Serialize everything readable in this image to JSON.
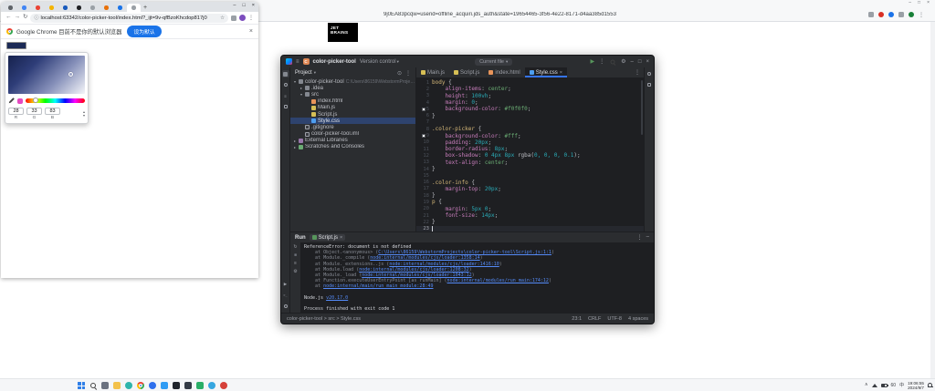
{
  "background_browser": {
    "url_fragment": "9j0EA83pcqw=userid=offline_acquiri.jds_auth&state=19654465-3f56-4e22-8171-d4aa385d1553",
    "logo_line1": "JET",
    "logo_line2": "BRAINS"
  },
  "chrome": {
    "tabs": [
      "#5f6368",
      "#4285f4",
      "#ea4335",
      "#f4b400",
      "#185abc",
      "#202124",
      "#9aa0a6",
      "#e8710a",
      "#1a73e8",
      "#9aa0a6"
    ],
    "active_tab": 9,
    "url": "localhost:63342/color-picker-tool/index.html?_ijt=9v-qfBzoKhcdop817j0",
    "notification": {
      "text": "Google Chrome 目前不是你的默认浏览器",
      "button_label": "设为默认"
    },
    "picker": {
      "rgb": [
        "28",
        "33",
        "83"
      ],
      "labels": [
        "R",
        "G",
        "B"
      ]
    }
  },
  "ide": {
    "title": {
      "project": "color-picker-tool",
      "project_initial": "C",
      "vcs": "Version control",
      "run_widget": "Current file"
    },
    "project_panel": {
      "header": "Project",
      "tree": [
        {
          "label": "color-picker-tool",
          "suffix": "C:\\Users\\86159\\WebstormProjects\\color-picker-tool",
          "indent": 0,
          "icon": "folder",
          "chev": "v"
        },
        {
          "label": ".idea",
          "indent": 1,
          "icon": "folder",
          "chev": ">"
        },
        {
          "label": "src",
          "indent": 1,
          "icon": "folder",
          "chev": "v"
        },
        {
          "label": "index.html",
          "indent": 2,
          "icon": "html"
        },
        {
          "label": "Main.js",
          "indent": 2,
          "icon": "js"
        },
        {
          "label": "Script.js",
          "indent": 2,
          "icon": "js"
        },
        {
          "label": "Style.css",
          "indent": 2,
          "icon": "css",
          "selected": true
        },
        {
          "label": ".gitignore",
          "indent": 1,
          "icon": "file"
        },
        {
          "label": "color-picker-tool.iml",
          "indent": 1,
          "icon": "file"
        },
        {
          "label": "External Libraries",
          "indent": 0,
          "icon": "lib",
          "chev": ">"
        },
        {
          "label": "Scratches and Consoles",
          "indent": 0,
          "icon": "scratch",
          "chev": ">"
        }
      ]
    },
    "editor": {
      "tabs": [
        {
          "label": "Main.js",
          "icon": "js"
        },
        {
          "label": "Script.js",
          "icon": "js"
        },
        {
          "label": "index.html",
          "icon": "html"
        },
        {
          "label": "Style.css",
          "icon": "css",
          "active": true
        }
      ],
      "lines": [
        {
          "n": "1",
          "parts": [
            [
              "sel",
              "body "
            ],
            [
              "pun",
              "{"
            ]
          ]
        },
        {
          "n": "2",
          "parts": [
            [
              "ws",
              "    "
            ],
            [
              "prop",
              "align-items"
            ],
            [
              "pun",
              ": "
            ],
            [
              "val",
              "center"
            ],
            [
              "pun",
              ";"
            ]
          ]
        },
        {
          "n": "3",
          "parts": [
            [
              "ws",
              "    "
            ],
            [
              "prop",
              "height"
            ],
            [
              "pun",
              ": "
            ],
            [
              "num",
              "100vh"
            ],
            [
              "pun",
              ";"
            ]
          ]
        },
        {
          "n": "4",
          "parts": [
            [
              "ws",
              "    "
            ],
            [
              "prop",
              "margin"
            ],
            [
              "pun",
              ": "
            ],
            [
              "num",
              "0"
            ],
            [
              "pun",
              ";"
            ]
          ]
        },
        {
          "n": "5",
          "swatch": "#f0f0f0",
          "parts": [
            [
              "ws",
              "    "
            ],
            [
              "prop",
              "background-color"
            ],
            [
              "pun",
              ": "
            ],
            [
              "val",
              "#f0f0f0"
            ],
            [
              "pun",
              ";"
            ]
          ]
        },
        {
          "n": "6",
          "parts": [
            [
              "pun",
              "}"
            ]
          ]
        },
        {
          "n": "7",
          "parts": []
        },
        {
          "n": "8",
          "parts": [
            [
              "sel",
              ".color-picker "
            ],
            [
              "pun",
              "{"
            ]
          ]
        },
        {
          "n": "9",
          "swatch": "#ffffff",
          "parts": [
            [
              "ws",
              "    "
            ],
            [
              "prop",
              "background-color"
            ],
            [
              "pun",
              ": "
            ],
            [
              "val",
              "#fff"
            ],
            [
              "pun",
              ";"
            ]
          ]
        },
        {
          "n": "10",
          "parts": [
            [
              "ws",
              "    "
            ],
            [
              "prop",
              "padding"
            ],
            [
              "pun",
              ": "
            ],
            [
              "num",
              "20px"
            ],
            [
              "pun",
              ";"
            ]
          ]
        },
        {
          "n": "11",
          "parts": [
            [
              "ws",
              "    "
            ],
            [
              "prop",
              "border-radius"
            ],
            [
              "pun",
              ": "
            ],
            [
              "num",
              "8px"
            ],
            [
              "pun",
              ";"
            ]
          ]
        },
        {
          "n": "12",
          "parts": [
            [
              "ws",
              "    "
            ],
            [
              "prop",
              "box-shadow"
            ],
            [
              "pun",
              ": "
            ],
            [
              "num",
              "0 4px 8px"
            ],
            [
              "pun",
              " rgba("
            ],
            [
              "num",
              "0, 0, 0, 0.1"
            ],
            [
              "pun",
              ");"
            ]
          ]
        },
        {
          "n": "13",
          "parts": [
            [
              "ws",
              "    "
            ],
            [
              "prop",
              "text-align"
            ],
            [
              "pun",
              ": "
            ],
            [
              "val",
              "center"
            ],
            [
              "pun",
              ";"
            ]
          ]
        },
        {
          "n": "14",
          "parts": [
            [
              "pun",
              "}"
            ]
          ]
        },
        {
          "n": "15",
          "parts": []
        },
        {
          "n": "16",
          "parts": [
            [
              "sel",
              ".color-info "
            ],
            [
              "pun",
              "{"
            ]
          ]
        },
        {
          "n": "17",
          "parts": [
            [
              "ws",
              "    "
            ],
            [
              "prop",
              "margin-top"
            ],
            [
              "pun",
              ": "
            ],
            [
              "num",
              "20px"
            ],
            [
              "pun",
              ";"
            ]
          ]
        },
        {
          "n": "18",
          "parts": [
            [
              "pun",
              "}"
            ]
          ]
        },
        {
          "n": "19",
          "parts": [
            [
              "sel",
              "p "
            ],
            [
              "pun",
              "{"
            ]
          ]
        },
        {
          "n": "20",
          "parts": [
            [
              "ws",
              "    "
            ],
            [
              "prop",
              "margin"
            ],
            [
              "pun",
              ": "
            ],
            [
              "num",
              "5px 0"
            ],
            [
              "pun",
              ";"
            ]
          ]
        },
        {
          "n": "21",
          "parts": [
            [
              "ws",
              "    "
            ],
            [
              "prop",
              "font-size"
            ],
            [
              "pun",
              ": "
            ],
            [
              "num",
              "14px"
            ],
            [
              "pun",
              ";"
            ]
          ]
        },
        {
          "n": "22",
          "parts": [
            [
              "pun",
              "}"
            ]
          ]
        },
        {
          "n": "23",
          "cursor": true,
          "parts": []
        }
      ]
    },
    "run": {
      "label": "Run",
      "tab": "Script.js",
      "console": [
        {
          "parts": [
            [
              "out",
              "ReferenceError: document is not defined"
            ]
          ]
        },
        {
          "parts": [
            [
              "dim",
              "    at Object.<anonymous> ("
            ],
            [
              "link",
              "C:\\Users\\86159\\WebstormProjects\\color-picker-tool\\Script.js:1:1"
            ],
            [
              "dim",
              ")"
            ]
          ]
        },
        {
          "parts": [
            [
              "dim",
              "    at Module._compile ("
            ],
            [
              "link",
              "node:internal/modules/cjs/loader:1358:14"
            ],
            [
              "dim",
              ")"
            ]
          ]
        },
        {
          "parts": [
            [
              "dim",
              "    at Module._extensions..js ("
            ],
            [
              "link",
              "node:internal/modules/cjs/loader:1416:10"
            ],
            [
              "dim",
              ")"
            ]
          ]
        },
        {
          "parts": [
            [
              "dim",
              "    at Module.load ("
            ],
            [
              "link",
              "node:internal/modules/cjs/loader:1208:32"
            ],
            [
              "dim",
              ")"
            ]
          ]
        },
        {
          "parts": [
            [
              "dim",
              "    at Module._load ("
            ],
            [
              "link",
              "node:internal/modules/cjs/loader:1043:12"
            ],
            [
              "dim",
              ")"
            ]
          ]
        },
        {
          "parts": [
            [
              "dim",
              "    at Function.executeUserEntryPoint [as runMain] ("
            ],
            [
              "link",
              "node:internal/modules/run_main:174:12"
            ],
            [
              "dim",
              ")"
            ]
          ]
        },
        {
          "parts": [
            [
              "dim",
              "    at "
            ],
            [
              "link",
              "node:internal/main/run_main_module:28:49"
            ]
          ]
        },
        {
          "parts": []
        },
        {
          "parts": [
            [
              "out",
              "Node.js "
            ],
            [
              "link",
              "v20.17.0"
            ]
          ]
        },
        {
          "parts": []
        },
        {
          "parts": [
            [
              "out",
              "Process finished with exit code 1"
            ]
          ]
        }
      ]
    },
    "status": {
      "breadcrumb": "color-picker-tool > src > Style.css",
      "caret": "23:1",
      "line_sep": "CRLF",
      "encoding": "UTF-8",
      "indent": "4 spaces"
    }
  },
  "taskbar": {
    "icons": [
      {
        "name": "start",
        "kind": "start"
      },
      {
        "name": "search",
        "kind": "lens"
      },
      {
        "name": "task-view",
        "kind": "fill",
        "bg": "#6b7280"
      },
      {
        "name": "file-explorer",
        "kind": "fill",
        "bg": "#f3c14b"
      },
      {
        "name": "edge",
        "kind": "fill",
        "bg": "#30b5ac",
        "round": true
      },
      {
        "name": "chrome",
        "kind": "chrome"
      },
      {
        "name": "app-blue",
        "kind": "fill",
        "bg": "#2f6fed",
        "round": true
      },
      {
        "name": "vscode",
        "kind": "fill",
        "bg": "#2f9cf4"
      },
      {
        "name": "webstorm",
        "kind": "fill",
        "bg": "#20242c"
      },
      {
        "name": "terminal",
        "kind": "fill",
        "bg": "#343b46"
      },
      {
        "name": "wechat",
        "kind": "fill",
        "bg": "#2aae67"
      },
      {
        "name": "qq",
        "kind": "fill",
        "bg": "#36a6e0",
        "round": true
      },
      {
        "name": "netease-music",
        "kind": "fill",
        "bg": "#d6413a",
        "round": true
      }
    ],
    "tray": {
      "battery_label": "60",
      "ime": "中",
      "time": "19:06:55",
      "date": "2024/9/7"
    }
  }
}
